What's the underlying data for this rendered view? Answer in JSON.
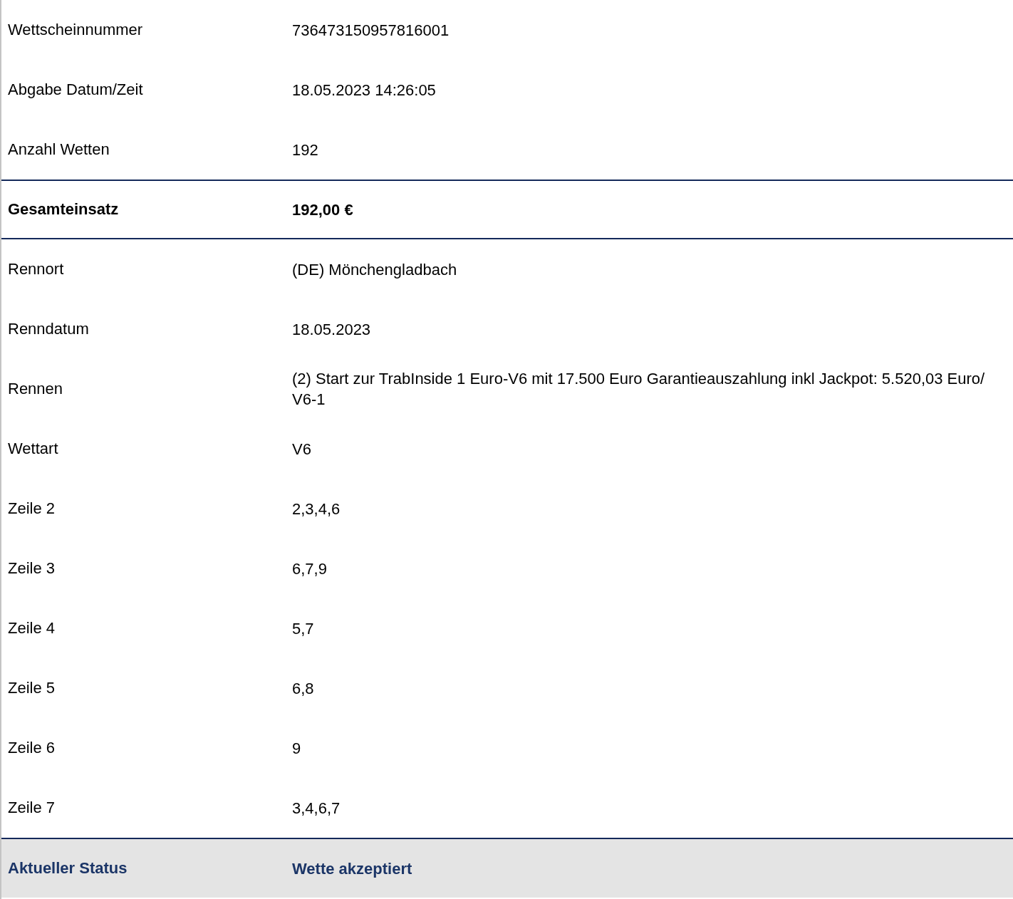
{
  "rows": [
    {
      "kind": "normal",
      "label": "Wettscheinnummer",
      "value": "736473150957816001"
    },
    {
      "kind": "normal",
      "label": "Abgabe Datum/Zeit",
      "value": "18.05.2023 14:26:05"
    },
    {
      "kind": "normal",
      "label": "Anzahl Wetten",
      "value": "192"
    },
    {
      "kind": "total",
      "label": "Gesamteinsatz",
      "value": "192,00 €"
    },
    {
      "kind": "normal",
      "label": "Rennort",
      "value": "(DE) Mönchengladbach"
    },
    {
      "kind": "normal",
      "label": "Renndatum",
      "value": "18.05.2023"
    },
    {
      "kind": "normal",
      "label": "Rennen",
      "value": "(2) Start zur TrabInside 1 Euro-V6 mit 17.500 Euro Garantieauszahlung inkl Jackpot: 5.520,03 Euro/ V6-1"
    },
    {
      "kind": "normal",
      "label": "Wettart",
      "value": "V6"
    },
    {
      "kind": "normal",
      "label": "Zeile 2",
      "value": "2,3,4,6"
    },
    {
      "kind": "normal",
      "label": "Zeile 3",
      "value": "6,7,9"
    },
    {
      "kind": "normal",
      "label": "Zeile 4",
      "value": "5,7"
    },
    {
      "kind": "normal",
      "label": "Zeile 5",
      "value": "6,8"
    },
    {
      "kind": "normal",
      "label": "Zeile 6",
      "value": "9"
    },
    {
      "kind": "normal",
      "label": "Zeile 7",
      "value": "3,4,6,7"
    },
    {
      "kind": "status",
      "label": "Aktueller Status",
      "value": "Wette akzeptiert"
    }
  ]
}
